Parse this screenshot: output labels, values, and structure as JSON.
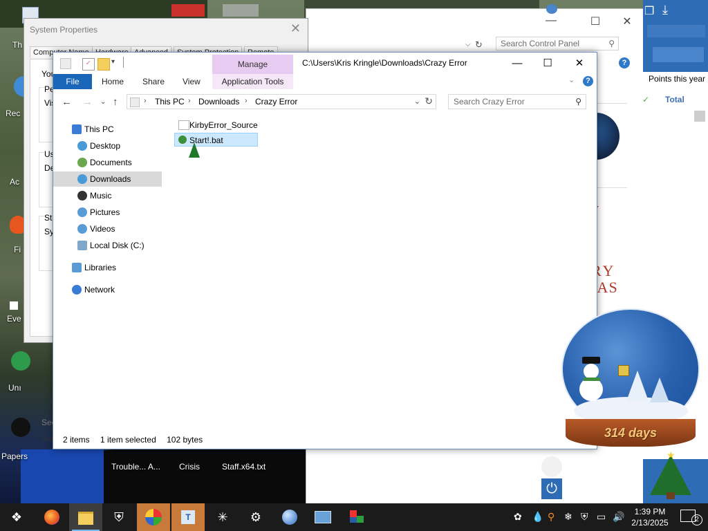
{
  "desktop": {
    "left_labels": [
      "Th",
      "Rec",
      "Ac",
      "Fi",
      "Eve",
      "Unı",
      "Papers"
    ],
    "taskbar_labels": [
      "Trouble... A...",
      "Crisis",
      "Staff.x64.txt"
    ]
  },
  "control_panel": {
    "search_placeholder": "Search Control Panel",
    "points_label": "Points this year",
    "total_label": "Total",
    "xmas_text_1": "RY",
    "xmas_text_2": "MAS"
  },
  "system_properties": {
    "title": "System Properties",
    "tabs": [
      "Computer Name",
      "Hardware",
      "Advanced",
      "System Protection",
      "Remote"
    ],
    "body_fragments": [
      "You",
      "Pe",
      "Vis",
      "Us",
      "De",
      "Sta",
      "Sy"
    ],
    "see_labels": [
      "See",
      "Sec"
    ]
  },
  "explorer": {
    "title_path": "C:\\Users\\Kris Kringle\\Downloads\\Crazy Error",
    "manage_label": "Manage",
    "app_tools_label": "Application Tools",
    "ribbon_tabs": [
      "File",
      "Home",
      "Share",
      "View"
    ],
    "address_segments": [
      "This PC",
      "Downloads",
      "Crazy Error"
    ],
    "search_placeholder": "Search Crazy Error",
    "nav": [
      {
        "label": "This PC",
        "icon": "pc-icon",
        "color": "#3a7bd5"
      },
      {
        "label": "Desktop",
        "icon": "desktop-icon",
        "color": "#4a9ad6"
      },
      {
        "label": "Documents",
        "icon": "documents-icon",
        "color": "#6aa84f"
      },
      {
        "label": "Downloads",
        "icon": "downloads-icon",
        "color": "#4a9ad6"
      },
      {
        "label": "Music",
        "icon": "music-icon",
        "color": "#333333"
      },
      {
        "label": "Pictures",
        "icon": "pictures-icon",
        "color": "#5b9bd5"
      },
      {
        "label": "Videos",
        "icon": "videos-icon",
        "color": "#5b9bd5"
      },
      {
        "label": "Local Disk (C:)",
        "icon": "disk-icon",
        "color": "#7fa7c9"
      },
      {
        "label": "Libraries",
        "icon": "libraries-icon",
        "color": "#5b9bd5"
      },
      {
        "label": "Network",
        "icon": "network-icon",
        "color": "#3a7bd5"
      }
    ],
    "selected_nav": "Downloads",
    "files": [
      {
        "name": "KirbyError_Source",
        "type": "folder"
      },
      {
        "name": "Start!.bat",
        "type": "bat",
        "selected": true
      }
    ],
    "status": {
      "count": "2 items",
      "selection": "1 item selected",
      "size": "102 bytes"
    }
  },
  "snow_globe": {
    "days_text": "314 days"
  },
  "taskbar": {
    "apps": [
      "start",
      "firefox",
      "file-explorer",
      "defender",
      "app-colorful",
      "app-t",
      "app-star",
      "settings",
      "app-globe",
      "app-monitor",
      "app-blocks"
    ],
    "time": "1:39 PM",
    "date": "2/13/2025",
    "notification_count": "2"
  }
}
